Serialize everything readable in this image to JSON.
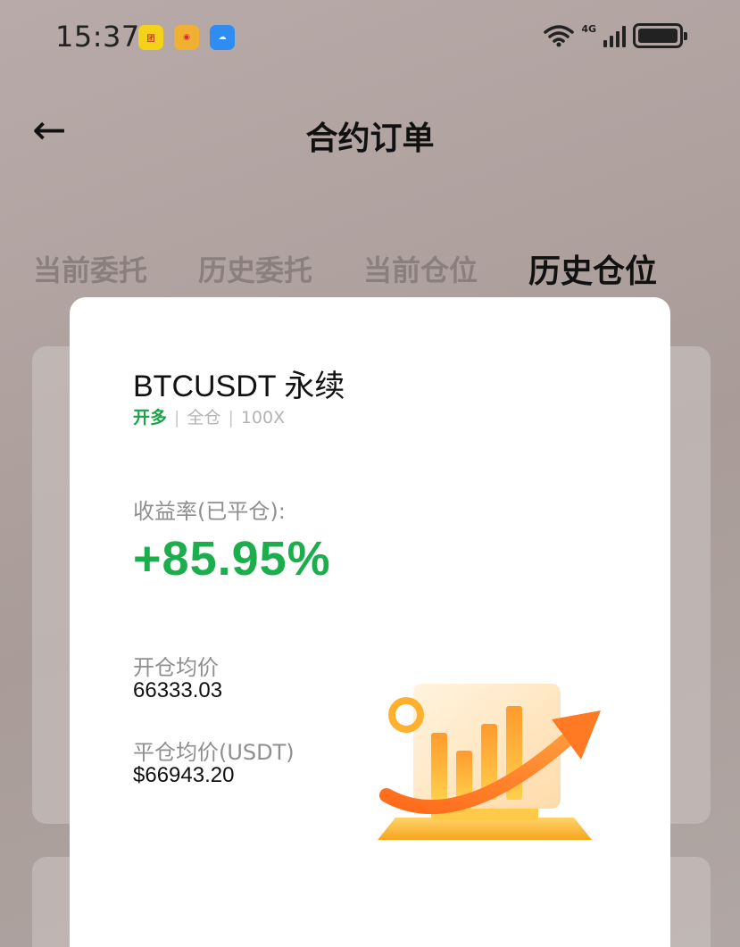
{
  "status_bar": {
    "time": "15:37",
    "network": "4G",
    "app_icons": [
      "app-icon-shop",
      "app-icon-weibo",
      "app-icon-weather"
    ]
  },
  "nav": {
    "back_icon": "arrow-left-icon",
    "title": "合约订单"
  },
  "tabs": [
    {
      "label": "当前委托",
      "active": false
    },
    {
      "label": "历史委托",
      "active": false
    },
    {
      "label": "当前仓位",
      "active": false
    },
    {
      "label": "历史仓位",
      "active": true
    }
  ],
  "share_card": {
    "pair": "BTCUSDT  永续",
    "side": "开多",
    "margin_mode": "全仓",
    "leverage": "100X",
    "pnl_ratio_label": "收益率(已平仓):",
    "pnl_ratio": "+85.95%",
    "open_price_label": "开仓均价",
    "open_price": "66333.03",
    "close_price_label": "平仓均价(USDT)",
    "close_price": "$66943.20",
    "illustration": "rising-chart-illustration"
  },
  "colors": {
    "profit_green": "#1cae4c",
    "side_green": "#1ca34a",
    "overlay": "#a99c98"
  }
}
